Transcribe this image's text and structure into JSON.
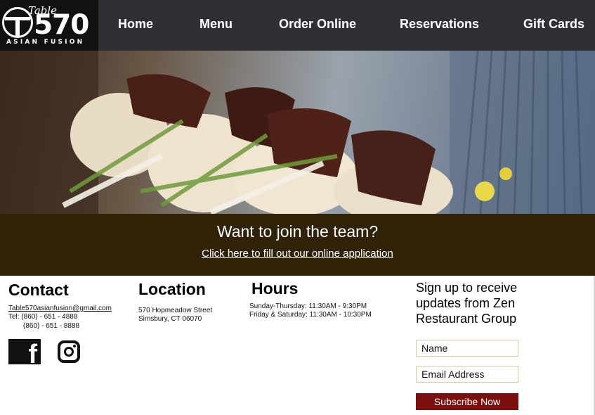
{
  "logo": {
    "script_text": "Table",
    "number": "570",
    "subtitle": "ASIAN FUSION"
  },
  "nav": {
    "items": [
      {
        "label": "Home"
      },
      {
        "label": "Menu"
      },
      {
        "label": "Order Online"
      },
      {
        "label": "Reservations"
      },
      {
        "label": "Gift Cards"
      }
    ]
  },
  "banner": {
    "title": "Want to join the team?",
    "link_text": "Click here to fill out our online application"
  },
  "contact": {
    "heading": "Contact",
    "email": "Table570asianfusion@gmail.com",
    "phone1": "Tel: (860) - 651 - 4888",
    "phone2": "(860) - 651 - 8888",
    "social": [
      {
        "name": "facebook-icon"
      },
      {
        "name": "instagram-icon"
      }
    ]
  },
  "location": {
    "heading": "Location",
    "line1": "570 Hopmeadow Street",
    "line2": "Simsbury, CT 06070"
  },
  "hours": {
    "heading": "Hours",
    "line1": "Sunday-Thursday: 11:30AM - 9:30PM",
    "line2": "Friday & Saturday: 11:30AM - 10:30PM"
  },
  "signup": {
    "text": "Sign up to receive updates from Zen Restaurant Group",
    "name_placeholder": "Name",
    "email_placeholder": "Email Address",
    "button_label": "Subscribe Now"
  },
  "colors": {
    "nav_bg": "#2e3035",
    "banner_bg": "#2f2206",
    "subscribe_bg": "#7b0f0f",
    "field_border": "#d8cba4"
  }
}
